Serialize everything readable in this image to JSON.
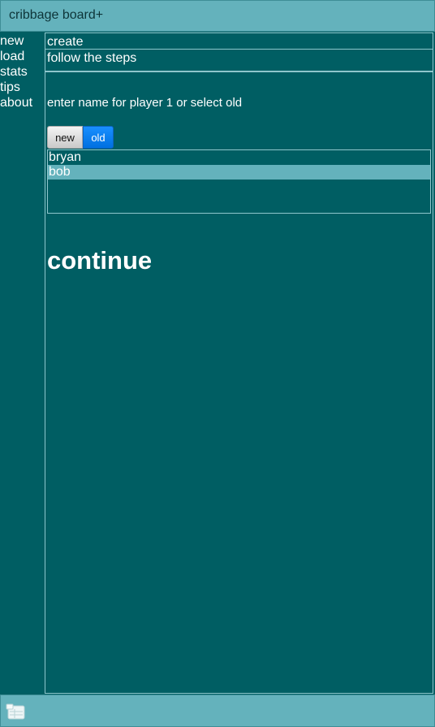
{
  "app": {
    "title": "cribbage board+"
  },
  "sidebar": {
    "items": [
      {
        "label": "new"
      },
      {
        "label": "load"
      },
      {
        "label": "stats"
      },
      {
        "label": "tips"
      },
      {
        "label": "about"
      }
    ]
  },
  "main": {
    "header": "create",
    "subheader": "follow the steps",
    "prompt": "enter name for player 1 or select old",
    "segmented": {
      "new_label": "new",
      "old_label": "old",
      "selected": "old"
    },
    "players": [
      {
        "name": "bryan",
        "selected": false
      },
      {
        "name": "bob",
        "selected": true
      }
    ],
    "continue_label": "continue"
  },
  "footer": {
    "icon": "board-icon"
  },
  "colors": {
    "background": "#005e63",
    "bar": "#64b2bc",
    "accent": "#0a84ff"
  }
}
